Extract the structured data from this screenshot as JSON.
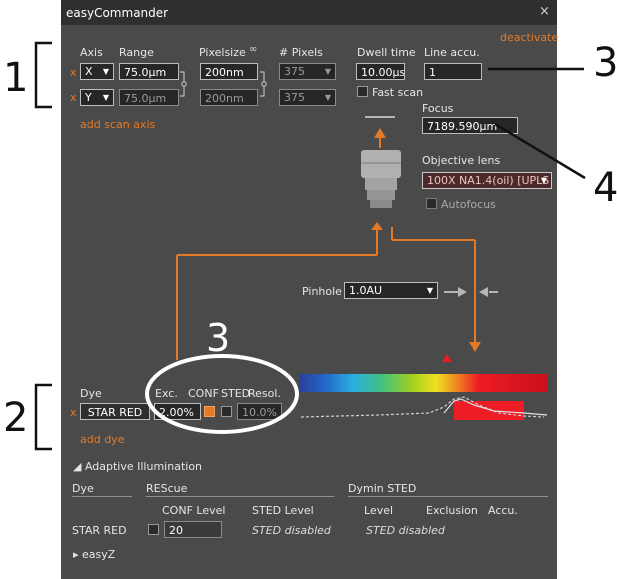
{
  "window": {
    "title": "easyCommander",
    "close_glyph": "×",
    "deactivate": "deactivate"
  },
  "scan": {
    "headers": {
      "axis": "Axis",
      "range": "Range",
      "pixelsize": "Pixelsize",
      "pixels": "# Pixels",
      "dwell": "Dwell time",
      "line_accu": "Line accu."
    },
    "rows": [
      {
        "remove": "x",
        "axis": "X",
        "range": "75.0µm",
        "pixelsize": "200nm",
        "pixels": "375"
      },
      {
        "remove": "x",
        "axis": "Y",
        "range": "75.0µm",
        "pixelsize": "200nm",
        "pixels": "375"
      }
    ],
    "dwell_time": "10.00µs",
    "line_accu": "1",
    "fast_scan": "Fast scan",
    "add_scan_axis": "add scan axis"
  },
  "focus": {
    "label": "Focus",
    "value": "7189.590µm"
  },
  "objective": {
    "label": "Objective lens",
    "value": "100X NA1.4(oil) [UPLS",
    "autofocus": "Autofocus"
  },
  "pinhole": {
    "label": "Pinhole",
    "value": "1.0AU"
  },
  "dye": {
    "headers": {
      "dye": "Dye",
      "exc": "Exc.",
      "conf": "CONF",
      "sted": "STED",
      "resol": "Resol."
    },
    "rows": [
      {
        "remove": "x",
        "name": "STAR RED",
        "exc": "2.00%",
        "resol": "10.0%"
      }
    ],
    "add_dye": "add dye"
  },
  "adaptive": {
    "toggle": "◢ Adaptive Illumination",
    "headers": {
      "dye": "Dye",
      "rescue": "REScue",
      "dymin": "Dymin STED"
    },
    "subheaders": {
      "conf_level": "CONF Level",
      "sted_level": "STED Level",
      "level": "Level",
      "exclusion": "Exclusion",
      "accu": "Accu."
    },
    "row": {
      "dye": "STAR RED",
      "conf_level": "20",
      "sted_level": "STED disabled",
      "dymin_level": "STED disabled"
    }
  },
  "easyz": {
    "toggle": "▸ easyZ"
  },
  "annotations": {
    "n1": "1",
    "n2": "2",
    "n3a": "3",
    "n3b": "3",
    "n4": "4"
  },
  "colors": {
    "accent": "#e57a26",
    "panel": "#4a4a4a",
    "titlebar": "#2f2f2f",
    "laser_red": "#ee1c24"
  }
}
